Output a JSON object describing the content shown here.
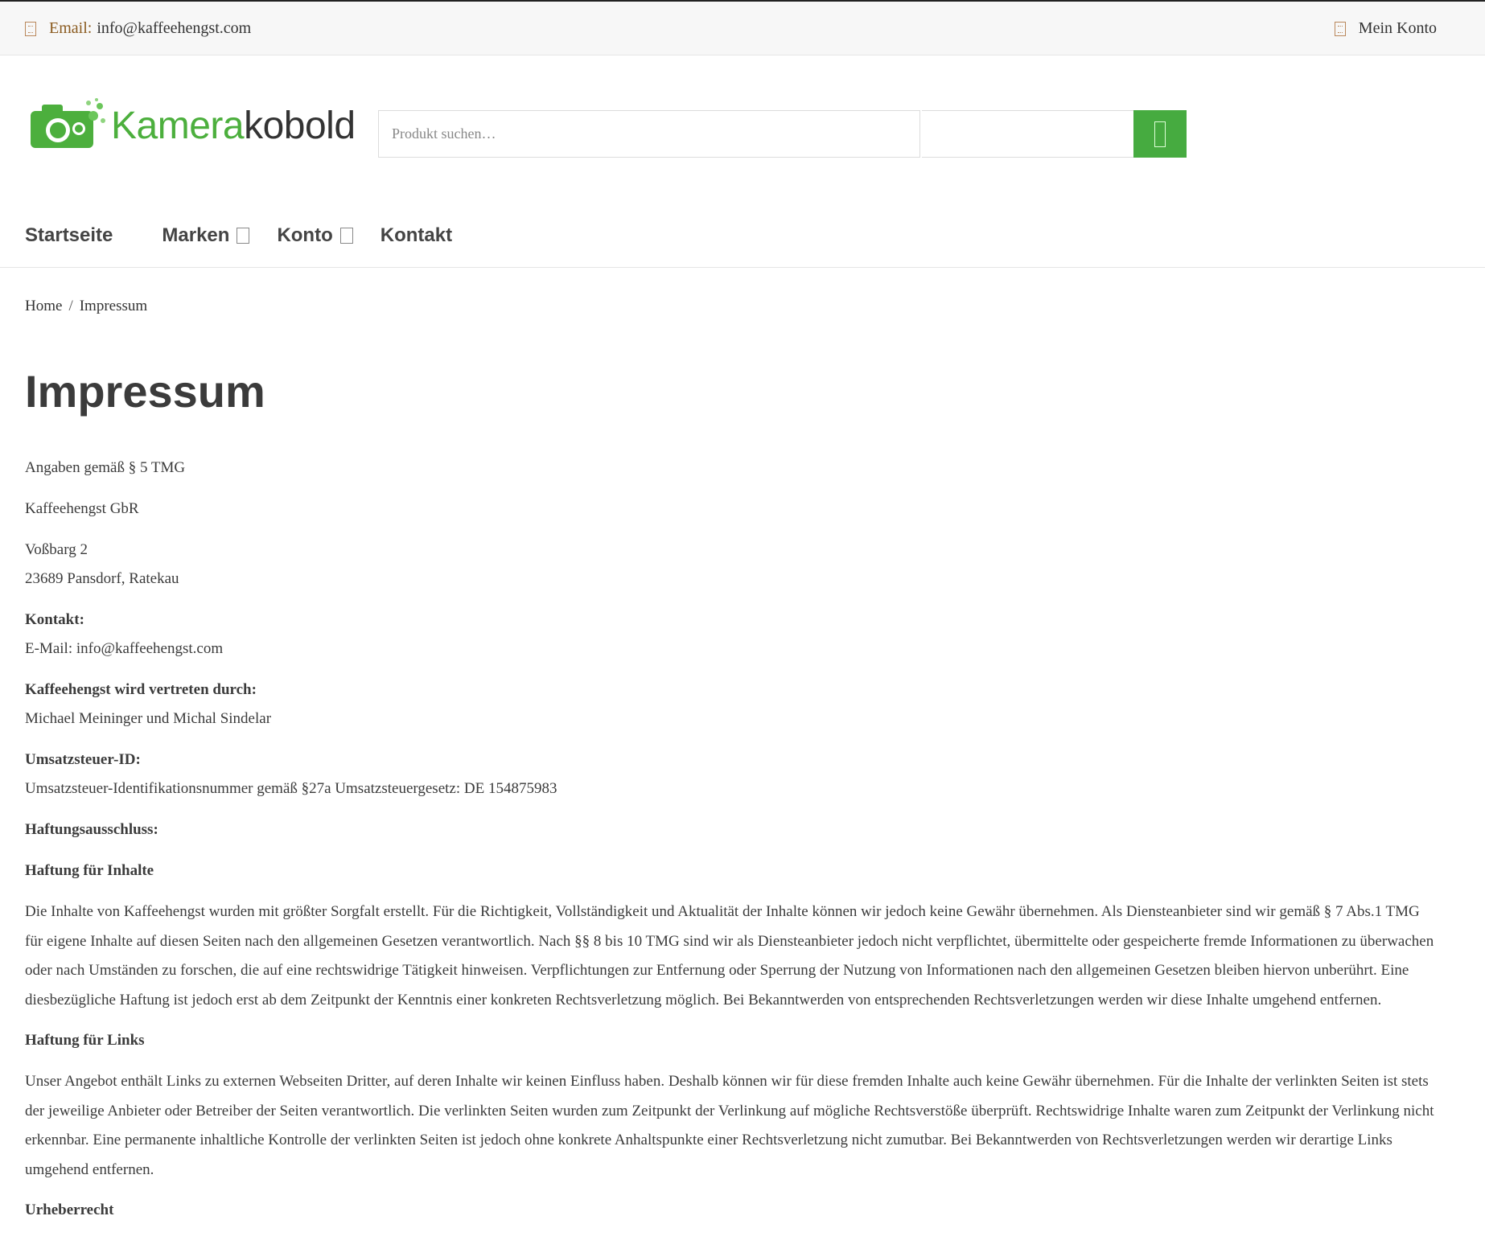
{
  "topbar": {
    "email_label": "Email:",
    "email_value": "info@kaffeehengst.com",
    "account_label": "Mein Konto"
  },
  "logo": {
    "word_part1": "Kamera",
    "word_part2": "kobold",
    "colors": {
      "green": "#4caf3d",
      "dark": "#333333"
    }
  },
  "search": {
    "placeholder": "Produkt suchen…",
    "button_color": "#46ab40"
  },
  "nav": {
    "items": [
      {
        "label": "Startseite"
      },
      {
        "label": "Marken"
      },
      {
        "label": "Konto"
      },
      {
        "label": "Kontakt"
      }
    ]
  },
  "breadcrumb": {
    "home": "Home",
    "separator": "/",
    "current": "Impressum"
  },
  "page": {
    "title": "Impressum",
    "angaben": "Angaben gemäß § 5 TMG",
    "company": "Kaffeehengst GbR",
    "street": "Voßbarg 2",
    "city": "23689 Pansdorf, Ratekau",
    "kontakt_heading": "Kontakt:",
    "kontakt_email": "E-Mail: info@kaffeehengst.com",
    "vertreten_heading": "Kaffeehengst wird vertreten durch:",
    "vertreten_names": "Michael Meininger und Michal Sindelar",
    "ust_heading": "Umsatzsteuer-ID:",
    "ust_text": "Umsatzsteuer-Identifikationsnummer gemäß §27a Umsatzsteuergesetz: DE 154875983",
    "haftung_heading": "Haftungsausschluss:",
    "inhalte_heading": "Haftung für Inhalte",
    "inhalte_text": "Die Inhalte von Kaffeehengst wurden mit größter Sorgfalt erstellt. Für die Richtigkeit, Vollständigkeit und Aktualität der Inhalte können wir jedoch keine Gewähr übernehmen. Als Diensteanbieter sind wir gemäß § 7 Abs.1 TMG für eigene Inhalte auf diesen Seiten nach den allgemeinen Gesetzen verantwortlich. Nach §§ 8 bis 10 TMG sind wir als Diensteanbieter jedoch nicht verpflichtet, übermittelte oder gespeicherte fremde Informationen zu überwachen oder nach Umständen zu forschen, die auf eine rechtswidrige Tätigkeit hinweisen. Verpflichtungen zur Entfernung oder Sperrung der Nutzung von Informationen nach den allgemeinen Gesetzen bleiben hiervon unberührt. Eine diesbezügliche Haftung ist jedoch erst ab dem Zeitpunkt der Kenntnis einer konkreten Rechtsverletzung möglich. Bei Bekanntwerden von entsprechenden Rechtsverletzungen werden wir diese Inhalte umgehend entfernen.",
    "links_heading": "Haftung für Links",
    "links_text": "Unser Angebot enthält Links zu externen Webseiten Dritter, auf deren Inhalte wir keinen Einfluss haben. Deshalb können wir für diese fremden Inhalte auch keine Gewähr übernehmen. Für die Inhalte der verlinkten Seiten ist stets der jeweilige Anbieter oder Betreiber der Seiten verantwortlich. Die verlinkten Seiten wurden zum Zeitpunkt der Verlinkung auf mögliche Rechtsverstöße überprüft. Rechtswidrige Inhalte waren zum Zeitpunkt der Verlinkung nicht erkennbar. Eine permanente inhaltliche Kontrolle der verlinkten Seiten ist jedoch ohne konkrete Anhaltspunkte einer Rechtsverletzung nicht zumutbar. Bei Bekanntwerden von Rechtsverletzungen werden wir derartige Links umgehend entfernen.",
    "urheber_heading": "Urheberrecht"
  }
}
